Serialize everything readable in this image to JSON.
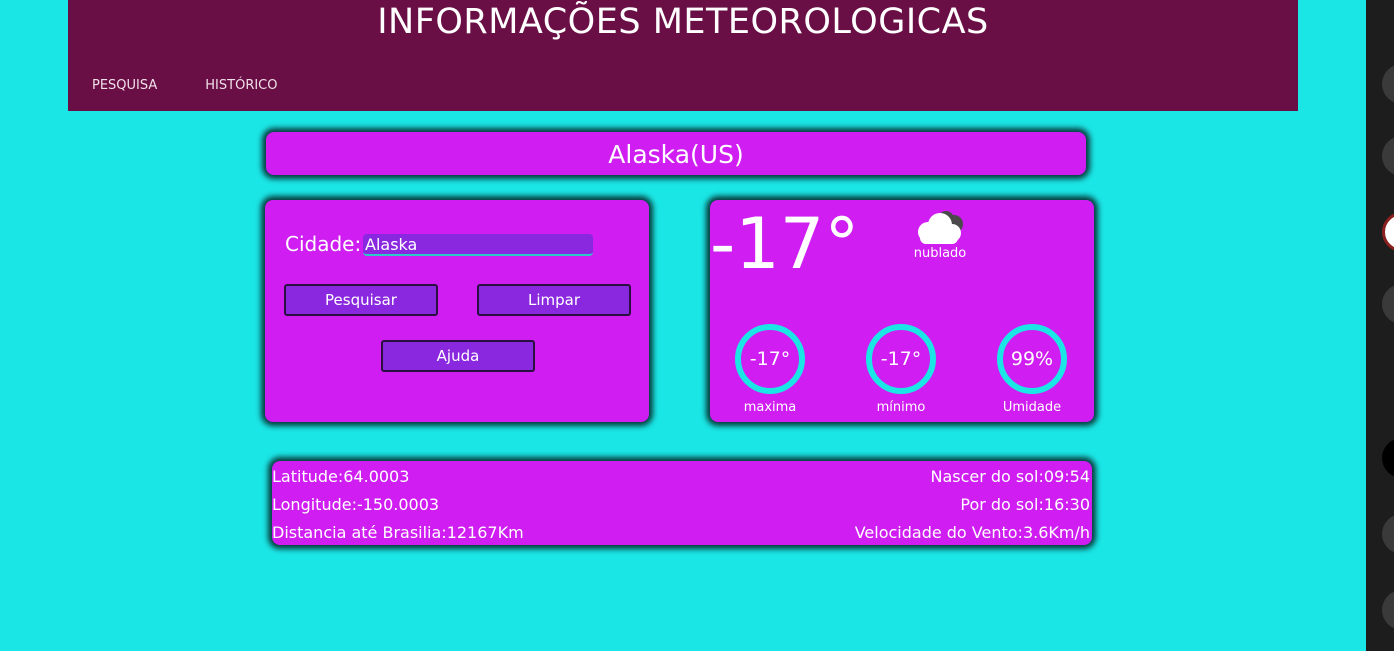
{
  "header": {
    "title": "INFORMAÇÕES METEOROLOGICAS",
    "nav": [
      "PESQUISA",
      "HISTÓRICO"
    ]
  },
  "city": {
    "name": "Alaska(US)"
  },
  "search": {
    "label": "Cidade:",
    "value": "Alaska",
    "buttons": {
      "search": "Pesquisar",
      "clear": "Limpar",
      "help": "Ajuda"
    }
  },
  "weather": {
    "temperature": "-17°",
    "condition": "nublado",
    "condition_icon": "cloud-icon",
    "gauges": [
      {
        "value": "-17°",
        "label": "maxima"
      },
      {
        "value": "-17°",
        "label": "mínimo"
      },
      {
        "value": "99%",
        "label": "Umidade"
      }
    ]
  },
  "info": {
    "left": [
      "Latitude:64.0003",
      "Longitude:-150.0003",
      "Distancia até Brasilia:12167Km"
    ],
    "right": [
      "Nascer do sol:09:54",
      "Por do sol:16:30",
      "Velocidade do Vento:3.6Km/h"
    ]
  },
  "colors": {
    "background": "#1be6e6",
    "header": "#6a0f45",
    "card": "#cf1df2",
    "button": "#8a28e0",
    "gauge_ring": "#1be6e6"
  }
}
